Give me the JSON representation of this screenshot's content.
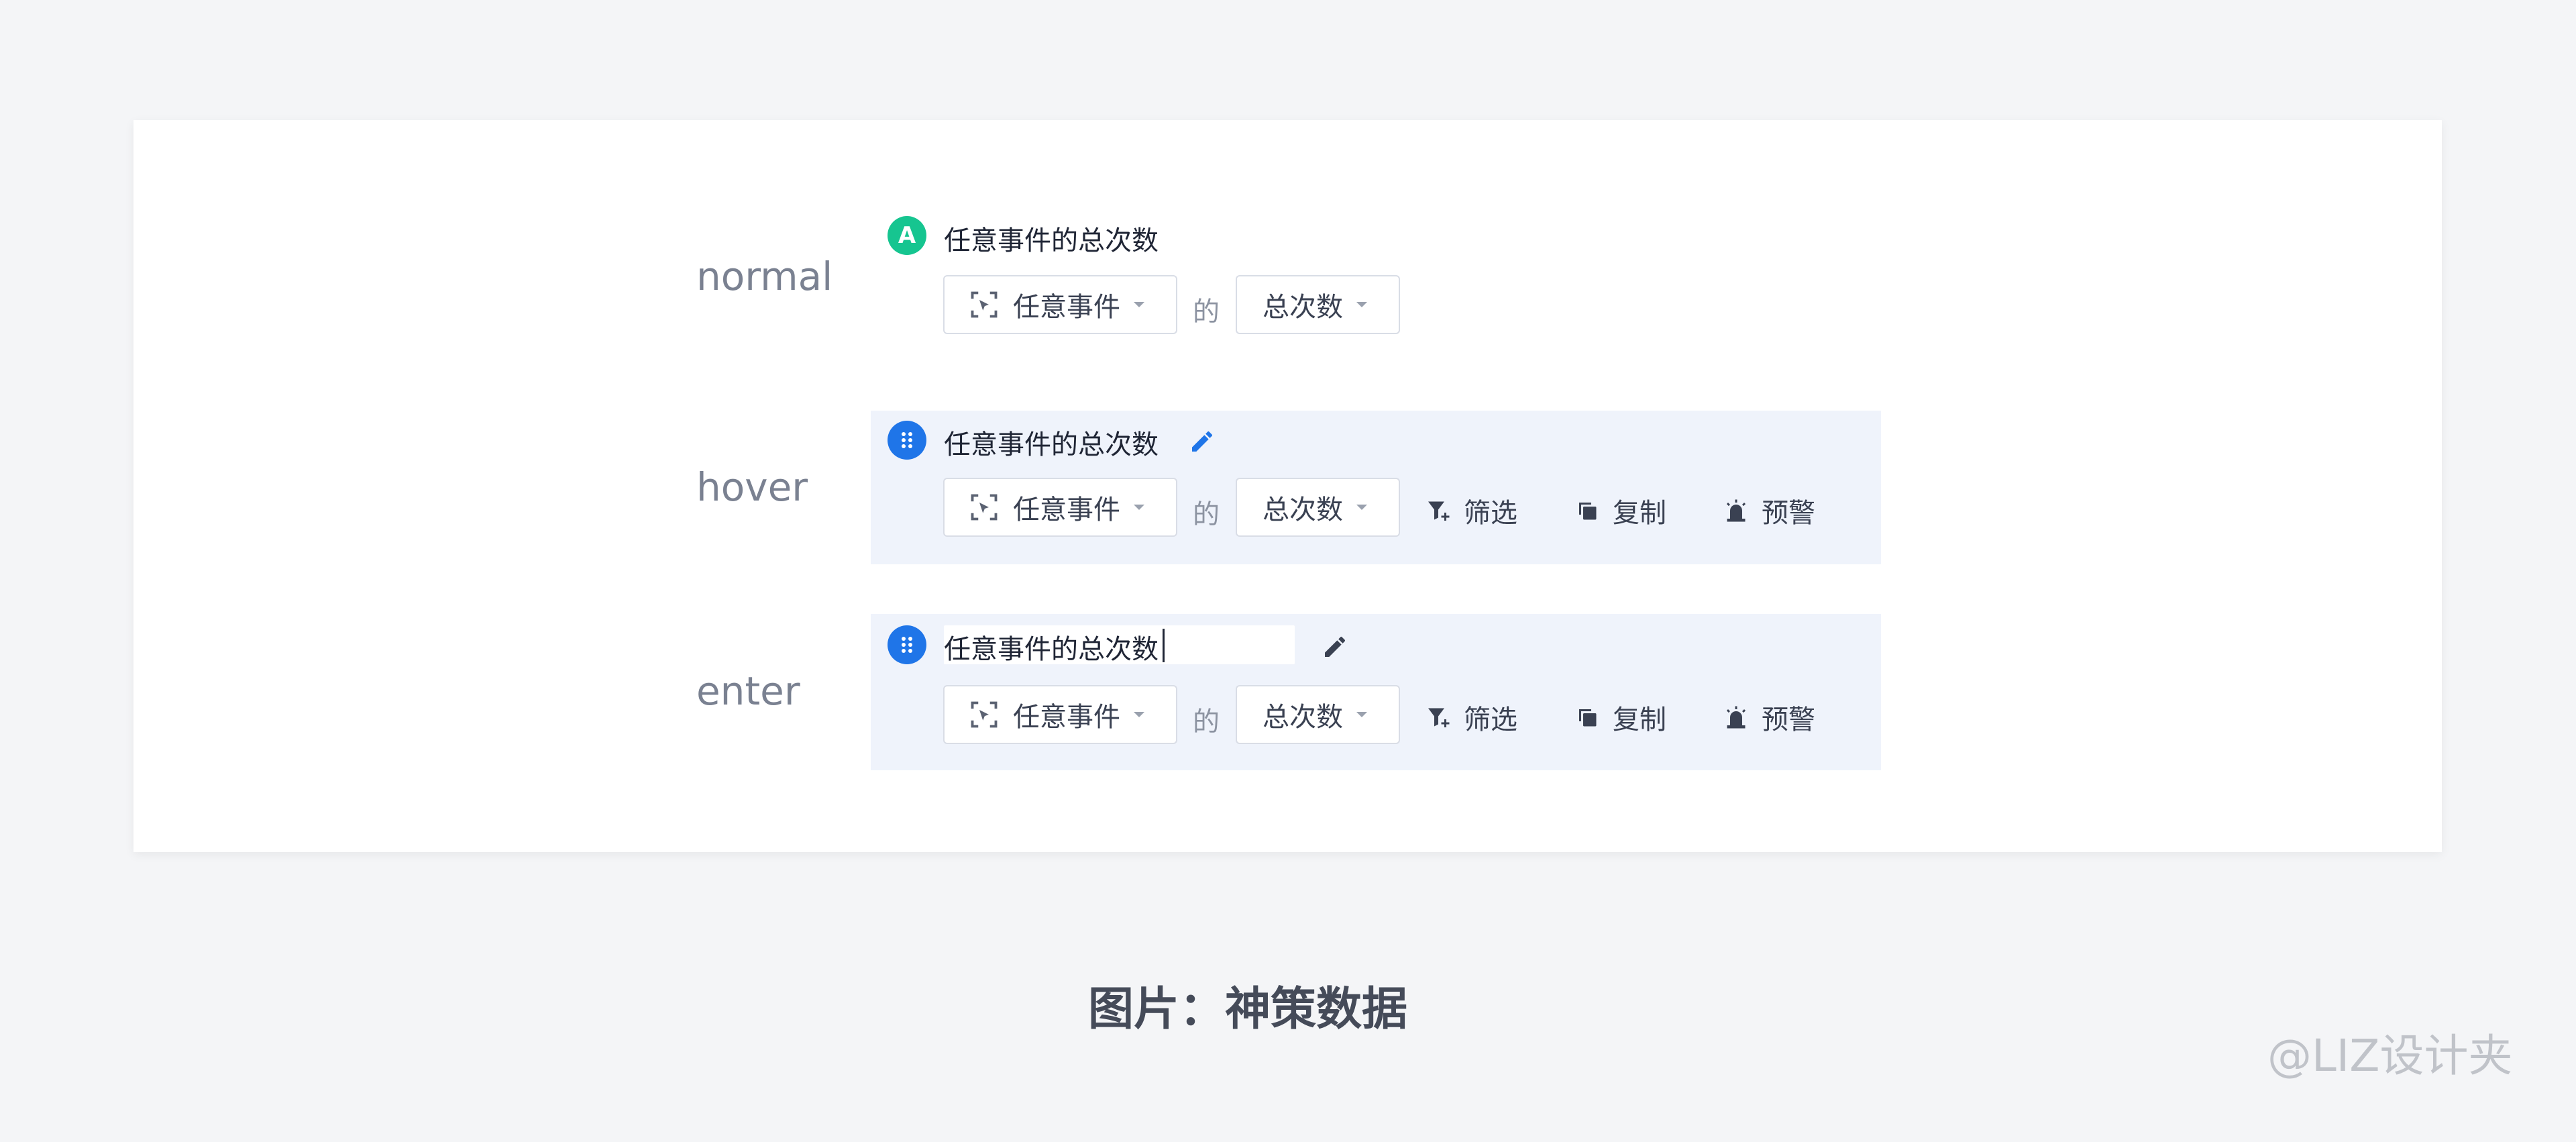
{
  "states": [
    {
      "label": "normal",
      "badge": "A",
      "metric_title": "任意事件的总次数",
      "event_selector": "任意事件",
      "connector": "的",
      "measure_selector": "总次数"
    },
    {
      "label": "hover",
      "metric_title": "任意事件的总次数",
      "event_selector": "任意事件",
      "connector": "的",
      "measure_selector": "总次数",
      "actions": {
        "filter": "筛选",
        "copy": "复制",
        "alert": "预警"
      }
    },
    {
      "label": "enter",
      "metric_title": "任意事件的总次数",
      "event_selector": "任意事件",
      "connector": "的",
      "measure_selector": "总次数",
      "actions": {
        "filter": "筛选",
        "copy": "复制",
        "alert": "预警"
      }
    }
  ],
  "caption": "图片：神策数据",
  "watermark": "@LIZ设计夹",
  "colors": {
    "accent_blue": "#1f75e8",
    "badge_green": "#16c590",
    "hover_bg": "#eff3fb",
    "page_bg": "#f4f5f7"
  },
  "icons": [
    "event-scan-icon",
    "caret-down-icon",
    "drag-handle-icon",
    "pencil-icon",
    "filter-icon",
    "copy-icon",
    "alarm-icon"
  ]
}
